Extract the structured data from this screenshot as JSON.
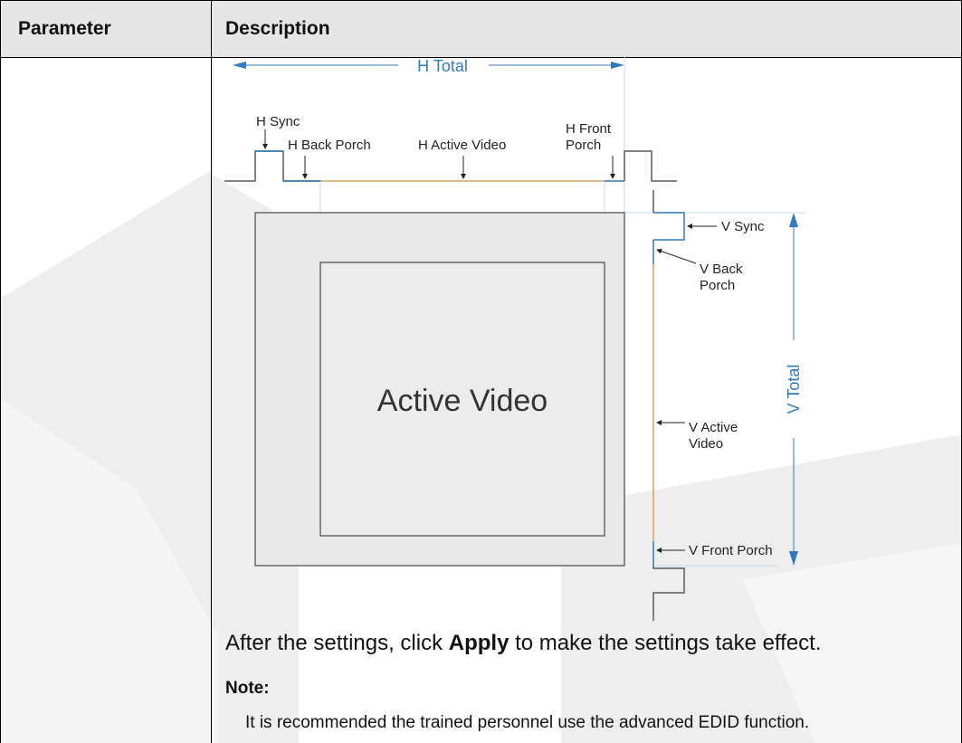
{
  "table": {
    "headers": [
      "Parameter",
      "Description"
    ]
  },
  "diagram": {
    "h_total": "H Total",
    "h_sync": "H Sync",
    "h_back_porch": "H Back Porch",
    "h_active_video": "H Active Video",
    "h_front_porch_line1": "H Front",
    "h_front_porch_line2": "Porch",
    "v_sync": "V Sync",
    "v_back_porch_line1": "V Back",
    "v_back_porch_line2": "Porch",
    "v_active_video_line1": "V Active",
    "v_active_video_line2": "Video",
    "v_front_porch": "V Front Porch",
    "v_total": "V Total",
    "active_video": "Active Video"
  },
  "content": {
    "apply_before": "After the settings, click ",
    "apply_bold": "Apply",
    "apply_after": " to make the settings take effect.",
    "note_label": "Note:",
    "note_text": "It is recommended the trained personnel use the advanced EDID function."
  },
  "colors": {
    "blue": "#2e7bbf",
    "orange": "#d9a35b",
    "header_bg": "#e6e6e6"
  }
}
